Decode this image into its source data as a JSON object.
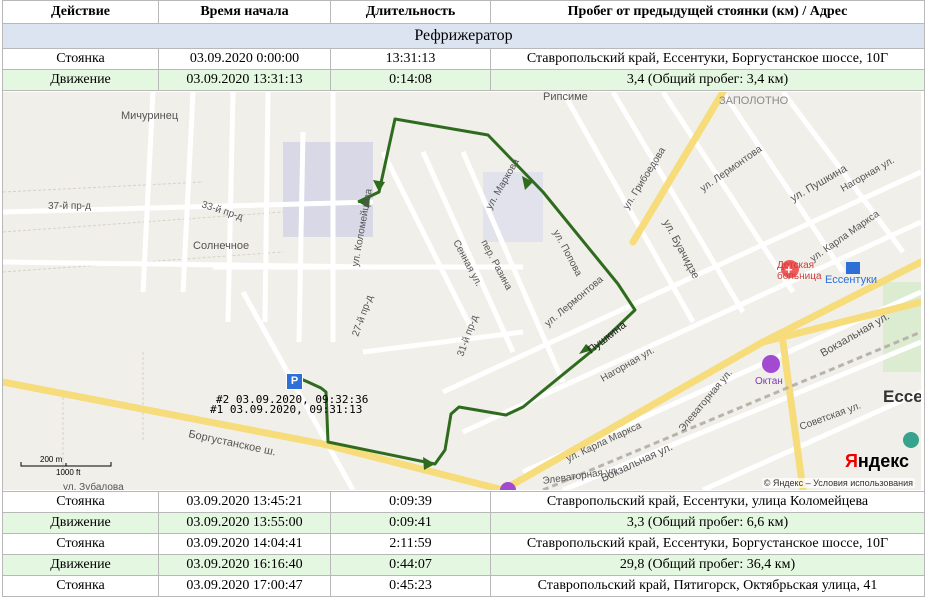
{
  "headers": [
    "Действие",
    "Время начала",
    "Длительность",
    "Пробег от предыдущей стоянки (км) / Адрес"
  ],
  "group_title": "Рефрижератор",
  "rows_top": [
    {
      "type": "stop",
      "action": "Стоянка",
      "start": "03.09.2020 0:00:00",
      "duration": "13:31:13",
      "info": "Ставропольский край, Ессентуки, Боргустанское шоссе, 10Г"
    },
    {
      "type": "move",
      "action": "Движение",
      "start": "03.09.2020 13:31:13",
      "duration": "0:14:08",
      "info": "3,4 (Общий пробег: 3,4 км)"
    }
  ],
  "rows_bottom": [
    {
      "type": "stop",
      "action": "Стоянка",
      "start": "03.09.2020 13:45:21",
      "duration": "0:09:39",
      "info": "Ставропольский край, Ессентуки, улица Коломейцева"
    },
    {
      "type": "move",
      "action": "Движение",
      "start": "03.09.2020 13:55:00",
      "duration": "0:09:41",
      "info": "3,3 (Общий пробег: 6,6 км)"
    },
    {
      "type": "stop",
      "action": "Стоянка",
      "start": "03.09.2020 14:04:41",
      "duration": "2:11:59",
      "info": "Ставропольский край, Ессентуки, Боргустанское шоссе, 10Г"
    },
    {
      "type": "move",
      "action": "Движение",
      "start": "03.09.2020 16:16:40",
      "duration": "0:44:07",
      "info": "29,8 (Общий пробег: 36,4 км)"
    },
    {
      "type": "stop",
      "action": "Стоянка",
      "start": "03.09.2020 17:00:47",
      "duration": "0:45:23",
      "info": "Ставропольский край, Пятигорск, Октябрьская улица, 41"
    }
  ],
  "map": {
    "marker1": "#1 03.09.2020, 09:31:13",
    "marker2": "#2 03.09.2020, 09:32:36",
    "parking_icon": "P",
    "scale_m": "200 m",
    "scale_ft": "1000 ft",
    "copyright": "© Яндекс – Условия использования",
    "logo_y": "Я",
    "logo_rest": "ндекс",
    "streets": {
      "kolom": "ул. Коломейцева",
      "borg": "Боргустанское ш.",
      "pushkina": "ул. Пушкина",
      "pushkina_route": "Пушкина",
      "buach": "ул. Буачидзе",
      "lermont": "ул. Лермонтова",
      "lermont2": "ул. Лермонтова",
      "marx": "ул. Карла Маркса",
      "marx2": "ул. Карла Маркса",
      "vokz": "Вокзальная ул.",
      "vokz2": "Вокзальная ул.",
      "michur": "Мичуринец",
      "solnech": "Солнечное",
      "rips": "Рипсиме",
      "zapol": "ЗАПОЛОТНО",
      "ess": "Ессентуки",
      "ess_big": "Ессе",
      "hosp1": "Детская",
      "hosp2": "больница",
      "oktan": "Октан",
      "p33": "33-й пр-д",
      "p37": "37-й пр-д",
      "p27": "27-й пр-д",
      "p31": "31-й пр-д",
      "sennaya": "Сенная ул.",
      "razina": "пер. Разина",
      "markova": "ул. Маркова",
      "popova": "ул. Попова",
      "griboed": "ул. Грибоедова",
      "nagornaya": "Нагорная ул.",
      "nagornaya2": "Нагорная ул.",
      "sovet": "Советская ул.",
      "elevat": "Элеваторная ул.",
      "elevat2": "Элеваторная ул.",
      "zubalova": "ул. Зубалова"
    }
  }
}
